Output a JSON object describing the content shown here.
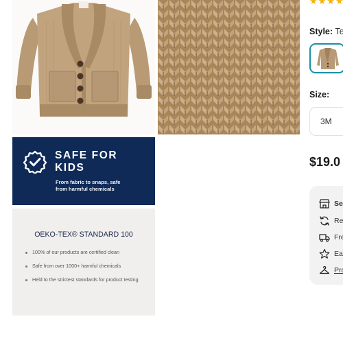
{
  "gallery": {
    "banner": {
      "title": "SAFE FOR\nKIDS",
      "subtitle": "From fabric to snaps, safe\nfrom harmful chemicals"
    },
    "certification": {
      "title": "OEKO-TEX® STANDARD 100",
      "points": [
        "100% of our products are certified clean",
        "Safe from over 1000+ harmful chemicals",
        "Held to the strictest standards for product testing"
      ]
    }
  },
  "product": {
    "rating_stars": "★★★★",
    "style_label": "Style:",
    "style_value": "Te",
    "size_label": "Size:",
    "size_option": "3M",
    "price": "$19.0",
    "info_rows": [
      {
        "icon": "store-icon",
        "text": "Se"
      },
      {
        "icon": "refresh-icon",
        "text": "Re"
      },
      {
        "icon": "truck-icon",
        "text": "Fre"
      },
      {
        "icon": "star-icon",
        "text": "Ea"
      },
      {
        "icon": "hanger-icon",
        "text": "Pro"
      }
    ]
  },
  "colors": {
    "banner_navy": "#0f2a57",
    "swatch_border": "#1a8fa6",
    "star_yellow": "#f4b400",
    "knit_tan": "#b08d62"
  }
}
